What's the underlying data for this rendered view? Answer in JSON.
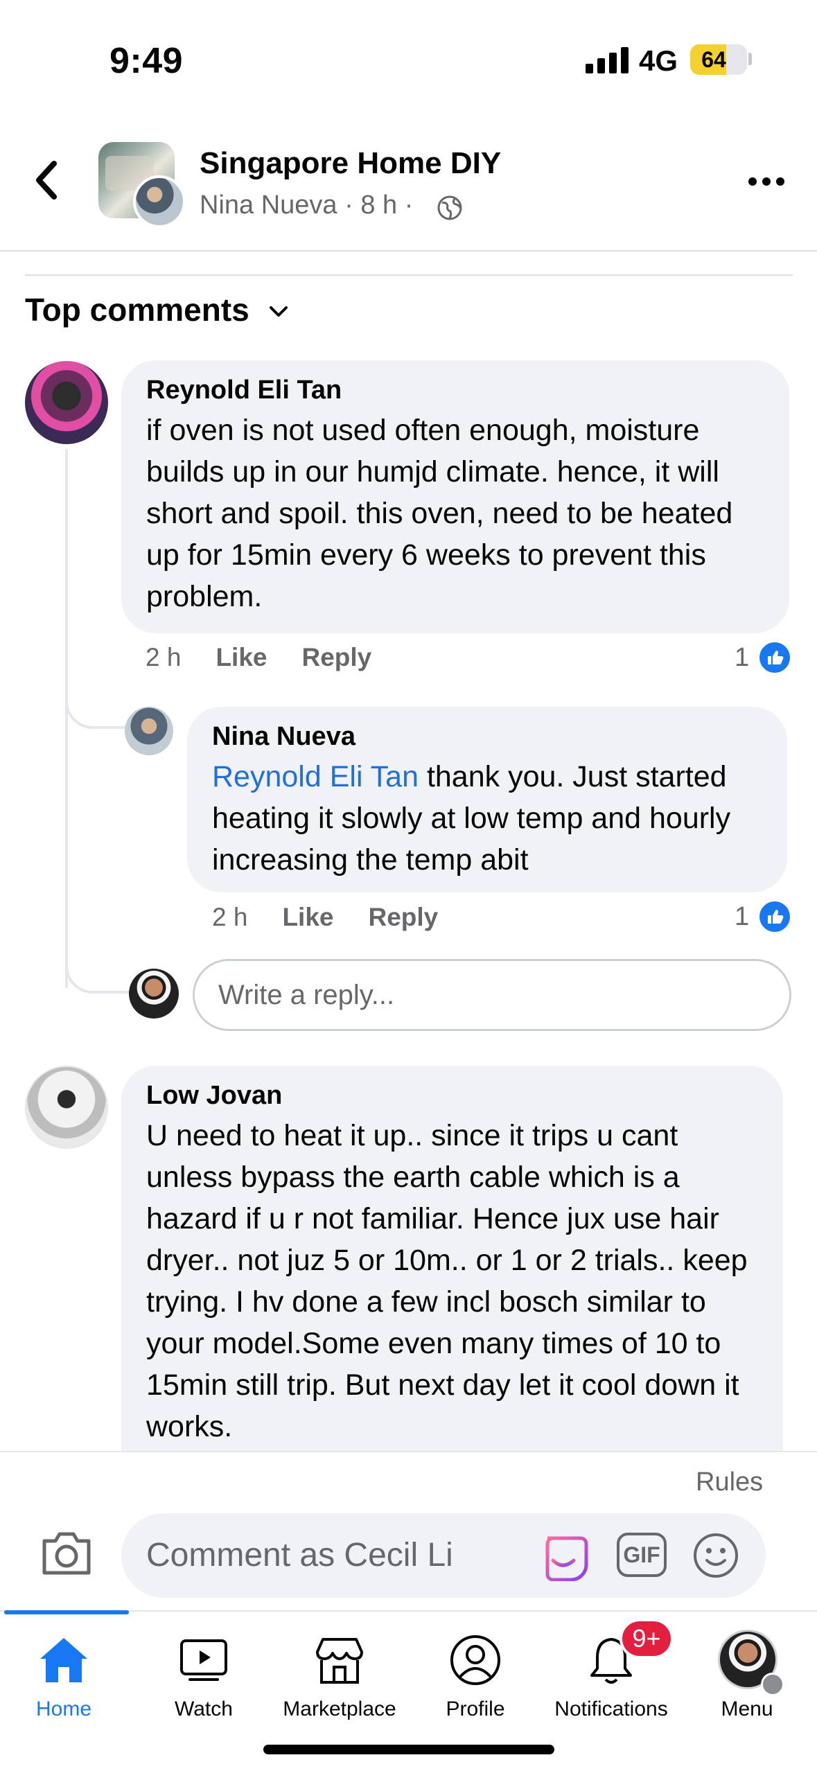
{
  "status_bar": {
    "time": "9:49",
    "network": "4G",
    "battery": "64",
    "battery_level": 0.64
  },
  "header": {
    "group_name": "Singapore Home DIY",
    "author": "Nina Nueva",
    "age": "8 h",
    "separator": "·",
    "icons": {
      "back": "chevron-left-icon",
      "privacy": "globe-icon",
      "more": "more-horizontal-icon"
    }
  },
  "comments_section": {
    "sort_label": "Top comments"
  },
  "comments": [
    {
      "author": "Reynold Eli Tan",
      "text": "if oven is not used often enough, moisture builds up in our humjd climate. hence, it will short and spoil. this oven, need to be heated up for 15min every 6 weeks to prevent this problem.",
      "time": "2 h",
      "like_label": "Like",
      "reply_label": "Reply",
      "reactions": "1"
    },
    {
      "author": "Nina Nueva",
      "mention": "Reynold Eli Tan",
      "text": " thank you. Just started heating it slowly at low temp and hourly increasing the temp abit",
      "time": "2 h",
      "like_label": "Like",
      "reply_label": "Reply",
      "reactions": "1"
    },
    {
      "author": "Low Jovan",
      "text": "U need to heat it up.. since it trips u cant unless bypass the earth cable which is a hazard if u r not familiar. Hence jux use hair dryer.. not juz 5 or 10m.. or 1 or 2 trials.. keep trying. I hv done a few incl bosch similar to your model.Some even many times of 10 to 15min still trip. But next day let it cool down it works."
    }
  ],
  "reply_box": {
    "placeholder": "Write a reply..."
  },
  "composer": {
    "rules_label": "Rules",
    "placeholder": "Comment as Cecil Li",
    "gif_label": "GIF"
  },
  "tabbar": {
    "tabs": [
      {
        "label": "Home",
        "icon": "home-icon",
        "active": true
      },
      {
        "label": "Watch",
        "icon": "video-icon"
      },
      {
        "label": "Marketplace",
        "icon": "marketplace-icon"
      },
      {
        "label": "Profile",
        "icon": "profile-icon"
      },
      {
        "label": "Notifications",
        "icon": "bell-icon",
        "badge": "9+"
      },
      {
        "label": "Menu",
        "icon": "menu-avatar"
      }
    ]
  },
  "colors": {
    "accent": "#1877f2",
    "mention": "#216fdb",
    "badge": "#e41e3f",
    "bubble": "#f0f2f5",
    "secondary_text": "#65676b"
  }
}
